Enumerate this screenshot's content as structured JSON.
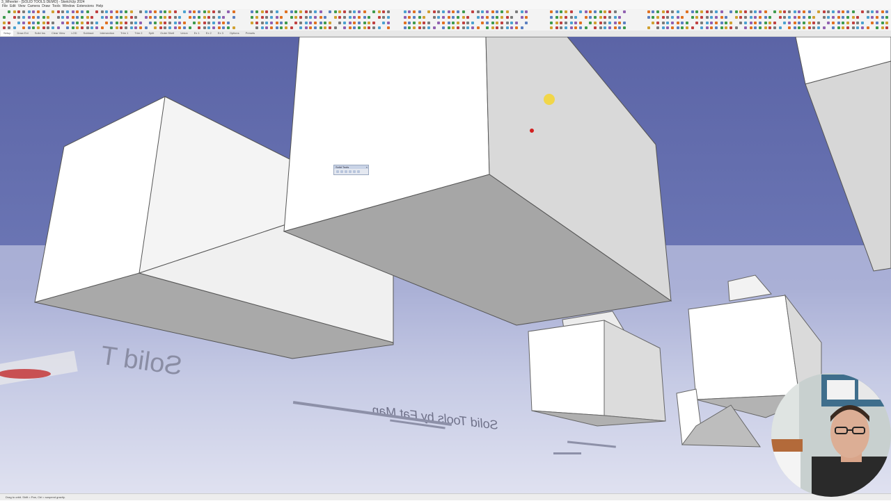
{
  "window": {
    "title": "3_Wheeler - [SOLID TOOLS DEMO] - SketchUp 2024"
  },
  "menu": {
    "items": [
      "File",
      "Edit",
      "View",
      "Camera",
      "Draw",
      "Tools",
      "Window",
      "Extensions",
      "Help"
    ]
  },
  "tabs": [
    "Setup",
    "Draw Ext",
    "Solid Ins",
    "Clear View",
    "LOD",
    "Subtract",
    "Intersection",
    "Trim 1",
    "Trim 2",
    "Split",
    "Outer Shell",
    "Union",
    "Ex 1",
    "Ex 2",
    "Ex 3",
    "Options",
    "Presets"
  ],
  "active_tab_index": 0,
  "solid_tools_toolbar": {
    "title": "Solid Tools",
    "close": "×",
    "icons": [
      "outer-shell-icon",
      "intersect-icon",
      "union-icon",
      "subtract-icon",
      "trim-icon",
      "split-icon"
    ]
  },
  "status": {
    "text": "Drag to orbit. Shift = Pan, Ctrl = suspend gravity."
  },
  "scene": {
    "sky_color": "#6670ae",
    "ground_color": "#dcdfee",
    "ground_text": [
      "Solid T",
      "Solid Tools by Fat Man"
    ]
  },
  "colors": {
    "record_red": "#e02020",
    "cursor_yellow": "#f0d030"
  }
}
